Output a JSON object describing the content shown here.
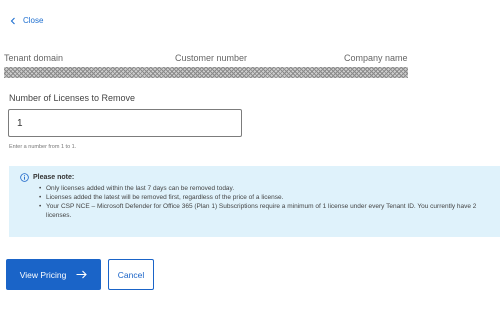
{
  "nav": {
    "close_label": "Close",
    "close_icon": "chevron-left-icon"
  },
  "details": {
    "headers": [
      "Tenant domain",
      "Customer number",
      "Company name"
    ]
  },
  "form": {
    "label": "Number of Licenses to Remove",
    "value": "1",
    "hint": "Enter a number from 1 to 1."
  },
  "note": {
    "icon": "info-icon",
    "title": "Please note:",
    "items": [
      "Only licenses added within the last 7 days can be removed today.",
      "Licenses added the latest will be removed first, regardless of the price of a license.",
      "Your CSP NCE – Microsoft Defender for Office 365 (Plan 1) Subscriptions require a minimum of 1 license under every Tenant ID. You currently have 2 licenses."
    ]
  },
  "actions": {
    "primary_label": "View Pricing",
    "primary_icon": "arrow-right-icon",
    "secondary_label": "Cancel"
  },
  "colors": {
    "accent": "#1a64c8",
    "note_bg": "#dff2fb"
  }
}
